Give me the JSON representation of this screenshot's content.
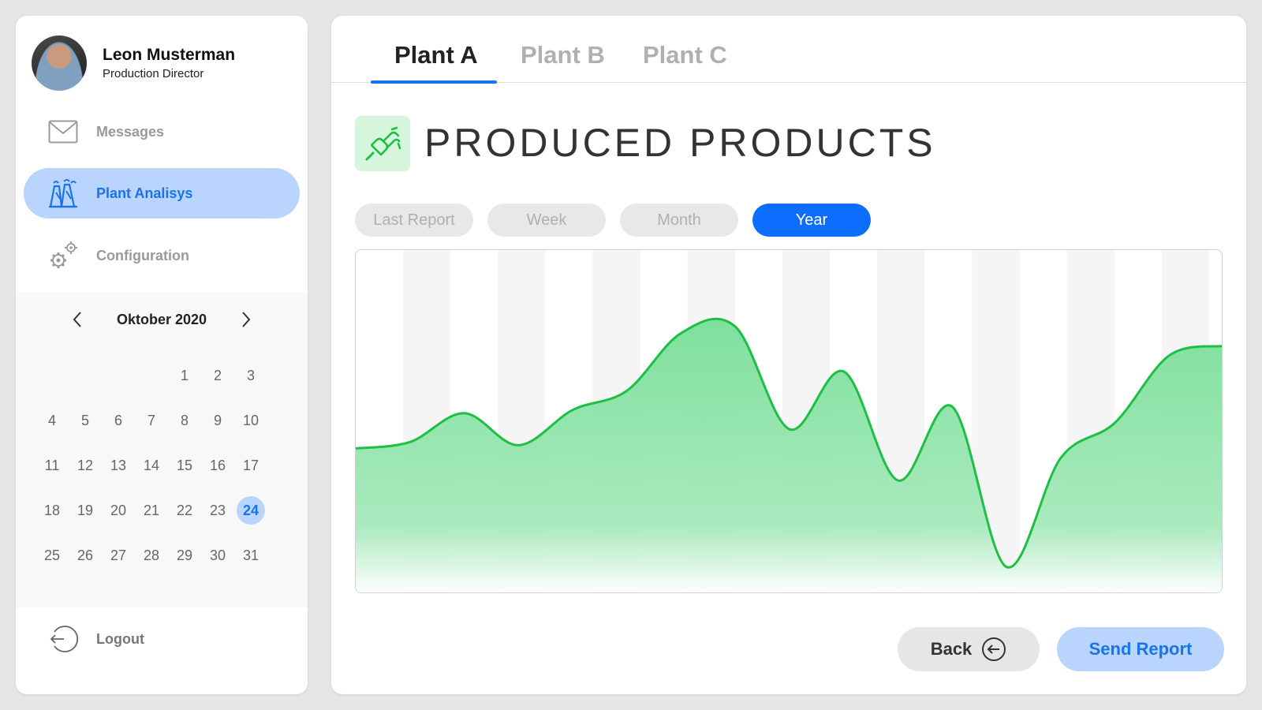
{
  "user": {
    "name": "Leon Musterman",
    "role": "Production Director"
  },
  "nav": {
    "messages": "Messages",
    "plant_analysis": "Plant Analisys",
    "configuration": "Configuration",
    "logout": "Logout"
  },
  "calendar": {
    "title": "Oktober 2020",
    "leading_blanks": 4,
    "days": [
      "1",
      "2",
      "3",
      "4",
      "5",
      "6",
      "7",
      "8",
      "9",
      "10",
      "11",
      "12",
      "13",
      "14",
      "15",
      "16",
      "17",
      "18",
      "19",
      "20",
      "21",
      "22",
      "23",
      "24",
      "25",
      "26",
      "27",
      "28",
      "29",
      "30",
      "31"
    ],
    "selected_day": "24"
  },
  "tabs": [
    "Plant A",
    "Plant B",
    "Plant C"
  ],
  "active_tab": "Plant A",
  "section": {
    "title": "PRODUCED PRODUCTS",
    "icon": "plug-icon"
  },
  "filters": [
    "Last Report",
    "Week",
    "Month",
    "Year"
  ],
  "active_filter": "Year",
  "buttons": {
    "back": "Back",
    "send": "Send Report"
  },
  "colors": {
    "accent": "#1a73e8",
    "accent_light": "#b9d5fd",
    "chart_line": "#1dbf45",
    "chart_fill": "#7ee09c"
  },
  "chart_data": {
    "type": "area",
    "title": "",
    "xlabel": "",
    "ylabel": "",
    "ylim": [
      0,
      100
    ],
    "grid": "vertical bands",
    "series": [
      {
        "values": [
          43,
          45,
          54,
          44,
          55,
          61,
          79,
          81,
          49,
          67,
          33,
          56,
          6,
          40,
          51,
          72,
          75
        ]
      }
    ]
  }
}
